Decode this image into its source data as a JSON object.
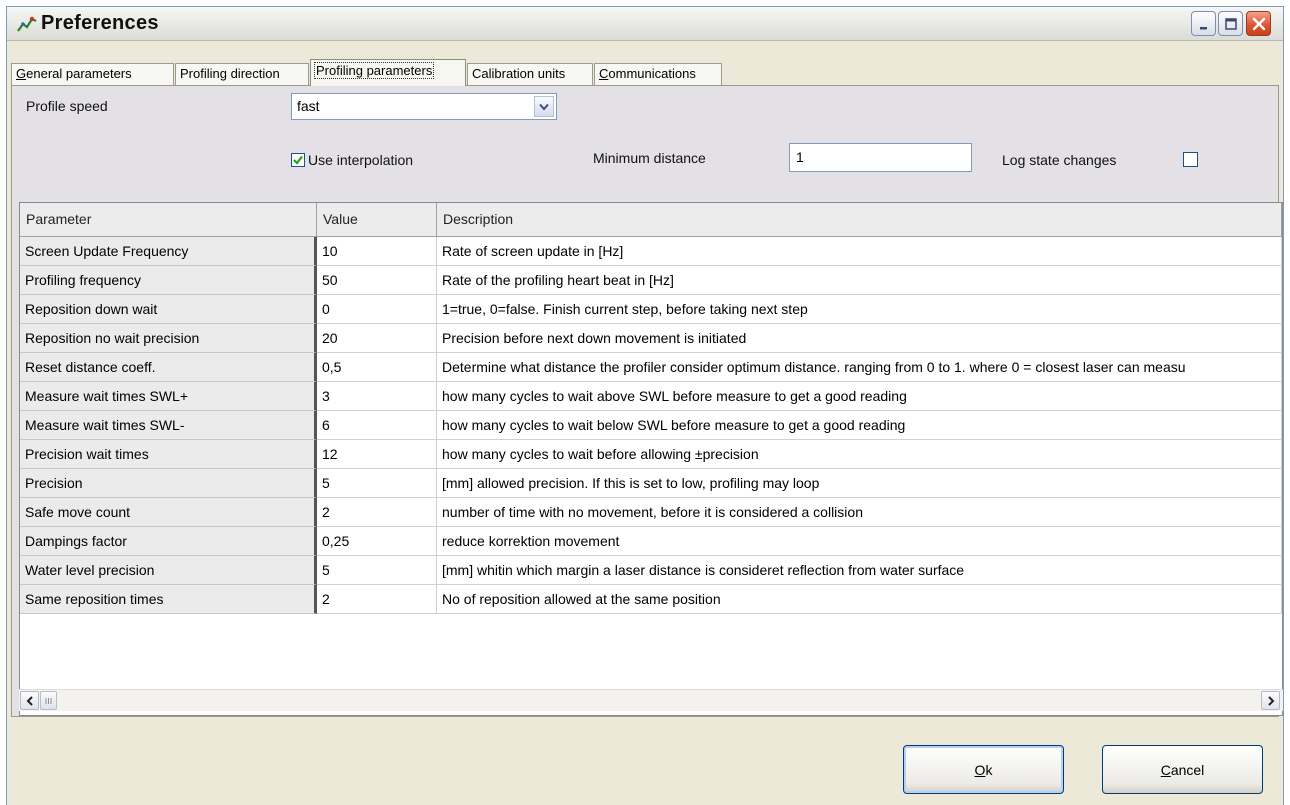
{
  "window": {
    "title": "Preferences"
  },
  "tabs": [
    {
      "label": "General parameters",
      "accel": "G",
      "rest": "eneral parameters",
      "active": false
    },
    {
      "label": "Profiling direction",
      "accel": "",
      "rest": "Profiling direction",
      "active": false
    },
    {
      "label": "Profiling parameters",
      "accel": "",
      "rest": "Profiling parameters",
      "active": true
    },
    {
      "label": "Calibration units",
      "accel": "",
      "rest": "Calibration units",
      "active": false
    },
    {
      "label": "Communications",
      "accel": "C",
      "rest": "ommunications",
      "active": false
    }
  ],
  "settings": {
    "profile_speed_label": "Profile speed",
    "profile_speed_value": "fast",
    "use_interpolation_label": "Use interpolation",
    "use_interpolation_checked": true,
    "min_distance_label": "Minimum distance",
    "min_distance_value": "1",
    "log_state_label": "Log state changes",
    "log_state_checked": false
  },
  "grid": {
    "headers": [
      "Parameter",
      "Value",
      "Description"
    ],
    "rows": [
      {
        "param": "Screen Update Frequency",
        "value": "10",
        "desc": "Rate of screen update in [Hz]"
      },
      {
        "param": "Profiling frequency",
        "value": "50",
        "desc": "Rate of the profiling heart beat in [Hz]"
      },
      {
        "param": "Reposition down wait",
        "value": "0",
        "desc": "1=true, 0=false. Finish current step, before taking next step"
      },
      {
        "param": "Reposition no wait precision",
        "value": "20",
        "desc": "Precision before next down movement is initiated"
      },
      {
        "param": "Reset distance coeff.",
        "value": "0,5",
        "desc": "Determine what distance the profiler consider optimum distance. ranging from 0 to 1.  where 0 = closest laser can measu"
      },
      {
        "param": "Measure wait times SWL+",
        "value": "3",
        "desc": "how many cycles to wait above SWL before measure to get a good reading"
      },
      {
        "param": "Measure wait times SWL-",
        "value": "6",
        "desc": "how many cycles to wait below SWL before measure to get a good reading"
      },
      {
        "param": "Precision wait times",
        "value": "12",
        "desc": "how many cycles to wait before allowing ±precision"
      },
      {
        "param": "Precision",
        "value": "5",
        "desc": "[mm] allowed precision. If this is set to low, profiling may loop"
      },
      {
        "param": "Safe move count",
        "value": "2",
        "desc": "number of time with no movement, before it is considered a collision"
      },
      {
        "param": "Dampings factor",
        "value": "0,25",
        "desc": "reduce korrektion movement"
      },
      {
        "param": "Water level precision",
        "value": "5",
        "desc": "[mm] whitin which margin a laser distance is consideret reflection from water surface"
      },
      {
        "param": "Same reposition times",
        "value": "2",
        "desc": "No of reposition allowed at the same position"
      }
    ]
  },
  "buttons": {
    "ok_accel": "O",
    "ok_rest": "k",
    "cancel_accel": "C",
    "cancel_rest": "ancel"
  },
  "icons": {
    "app": "chart-icon",
    "minimize": "minimize-icon",
    "maximize": "maximize-icon",
    "close": "close-icon",
    "dropdown": "chevron-down-icon",
    "scroll_left": "arrow-left-icon",
    "scroll_right": "arrow-right-icon"
  },
  "colors": {
    "close_button": "#d9532f",
    "check_mark": "#21a121",
    "panel_bg": "#e3e1e5"
  }
}
